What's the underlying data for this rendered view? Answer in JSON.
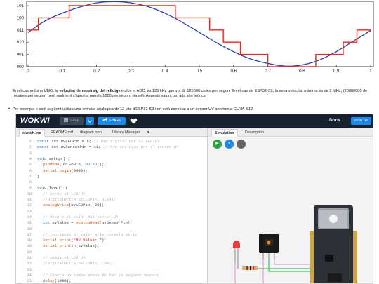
{
  "chart_data": {
    "type": "line",
    "x_ticks": [
      "0",
      "0.1",
      "0.2",
      "0.3",
      "0.4",
      "0.5",
      "0.6",
      "0.7",
      "0.8",
      "0.9",
      "1"
    ],
    "y_ticks": [
      "000",
      "001",
      "010",
      "011",
      "100",
      "101"
    ],
    "series": [
      {
        "color": "#2b3fae",
        "style": "smooth",
        "x": [
          0,
          0.05,
          0.1,
          0.15,
          0.2,
          0.25,
          0.3,
          0.35,
          0.4,
          0.45,
          0.5,
          0.55,
          0.6,
          0.65,
          0.7,
          0.75,
          0.8,
          0.85,
          0.9,
          0.95,
          1.0
        ],
        "y": [
          2.8,
          3.8,
          4.4,
          4.9,
          5.25,
          5.35,
          5.25,
          4.95,
          4.4,
          3.65,
          2.8,
          1.95,
          1.2,
          0.6,
          0.25,
          0.0,
          0.1,
          0.5,
          1.2,
          2.1,
          2.95
        ]
      },
      {
        "color": "#e52b1f",
        "style": "step",
        "x": [
          0,
          0.03,
          0.07,
          0.12,
          0.18,
          0.32,
          0.38,
          0.43,
          0.47,
          0.53,
          0.57,
          0.62,
          0.66,
          0.7,
          0.8,
          0.84,
          0.88,
          0.92,
          0.96,
          1.0
        ],
        "y": [
          3,
          4,
          4,
          5,
          5,
          5,
          5,
          4,
          4,
          3,
          2,
          1,
          1,
          0,
          0,
          1,
          1,
          2,
          3,
          3
        ]
      }
    ],
    "xlim": [
      0,
      1
    ],
    "ylim": [
      0,
      5
    ],
    "grid": false
  },
  "doc": {
    "para1_pre": "En el cas arduino UNO, la ",
    "para1_bold": "velocitat de mostreig del rellotge",
    "para1_post": " inclòs el ADC, és 125 kHz que vol dir 125000 cicles per segon. En el cas de ESP32-S3, la seva velocitat màxima és de 2 MHz, (20000000 de mostres per segon) però realment s'aprofita només 1000 per segon, via wifi. Aquests valors tan alts són teòrics",
    "bullet": "Per exemple e codi següent utilitza una entrada analògica de 12 bits d'ESP32-S3 i on està conectat a un sensor UV anomenat GUVA-S12"
  },
  "wokwi": {
    "logo": "WOKWI",
    "save_label": "SAVE",
    "share_label": "SHARE",
    "docs_label": "Docs",
    "signup_label": "SIGN UP",
    "editor_tabs": [
      "sketch.ino",
      "README.md",
      "diagram.json",
      "Library Manager"
    ],
    "sim_tabs": [
      "Simulation",
      "Description"
    ],
    "code_lines": [
      {
        "n": "1",
        "t": "const int uvLEDPin = 5; // Pin digital per al LED UV"
      },
      {
        "n": "2",
        "t": "const int uvSensorPin = 11; // Pin analògic per al sensor UV"
      },
      {
        "n": "3",
        "t": ""
      },
      {
        "n": "4",
        "t": "void setup() {"
      },
      {
        "n": "5",
        "t": "pinMode(uvLEDPin, OUTPUT);"
      },
      {
        "n": "6",
        "t": "Serial.begin(9600);"
      },
      {
        "n": "7",
        "t": "}"
      },
      {
        "n": "8",
        "t": ""
      },
      {
        "n": "9",
        "t": "void loop() {"
      },
      {
        "n": "10",
        "t": "// Encén el LED UV"
      },
      {
        "n": "11",
        "t": "//digitalWrite(uvLEDPin, HIGH);"
      },
      {
        "n": "12",
        "t": "analogWrite(uvLEDPin, 80);"
      },
      {
        "n": "13",
        "t": ""
      },
      {
        "n": "14",
        "t": "// Mesura el valor del sensor UV"
      },
      {
        "n": "15",
        "t": "int uvValue = analogRead(uvSensorPin);"
      },
      {
        "n": "16",
        "t": ""
      },
      {
        "n": "17",
        "t": "// Imprimeix el valor a la consola sèrie"
      },
      {
        "n": "18",
        "t": "Serial.print(\"UV Value: \");"
      },
      {
        "n": "19",
        "t": "Serial.println(uvValue);"
      },
      {
        "n": "20",
        "t": ""
      },
      {
        "n": "21",
        "t": "// Apaga el LED UV"
      },
      {
        "n": "22",
        "t": "//digitalWrite(uvLEDPin, LOW);"
      },
      {
        "n": "23",
        "t": ""
      },
      {
        "n": "24",
        "t": "// Espera un temps abans de fer la següent mesura"
      },
      {
        "n": "25",
        "t": "delay(1000);"
      }
    ],
    "colors": {
      "topbar": "#17212f",
      "accent": "#1e88e5",
      "play": "#2ea043",
      "wire_pink": "#e79ad9",
      "wire_green": "#34c759"
    }
  }
}
